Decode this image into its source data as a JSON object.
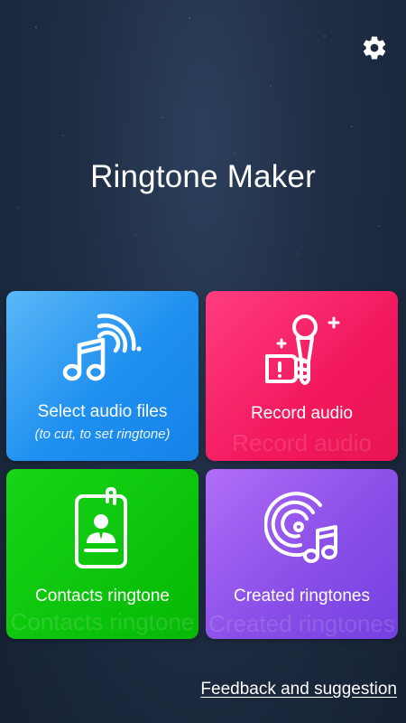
{
  "app": {
    "title": "Ringtone Maker"
  },
  "header": {
    "settings_icon": "gear-icon"
  },
  "tiles": {
    "select_audio": {
      "label": "Select audio files",
      "subtitle": "(to cut, to set ringtone)",
      "icon": "music-note-wave-icon",
      "color": "#1e8ff0"
    },
    "record_audio": {
      "label": "Record audio",
      "ghost_label": "Record audio",
      "icon": "microphone-icon",
      "color": "#f2185d"
    },
    "contacts_ringtone": {
      "label": "Contacts ringtone",
      "ghost_label": "Contacts ringtone",
      "icon": "contact-card-icon",
      "color": "#0bc40b"
    },
    "created_ringtones": {
      "label": "Created ringtones",
      "ghost_label": "Created ringtones",
      "icon": "disc-music-icon",
      "color": "#8a4fe8"
    }
  },
  "footer": {
    "feedback_label": "Feedback and suggestion"
  }
}
